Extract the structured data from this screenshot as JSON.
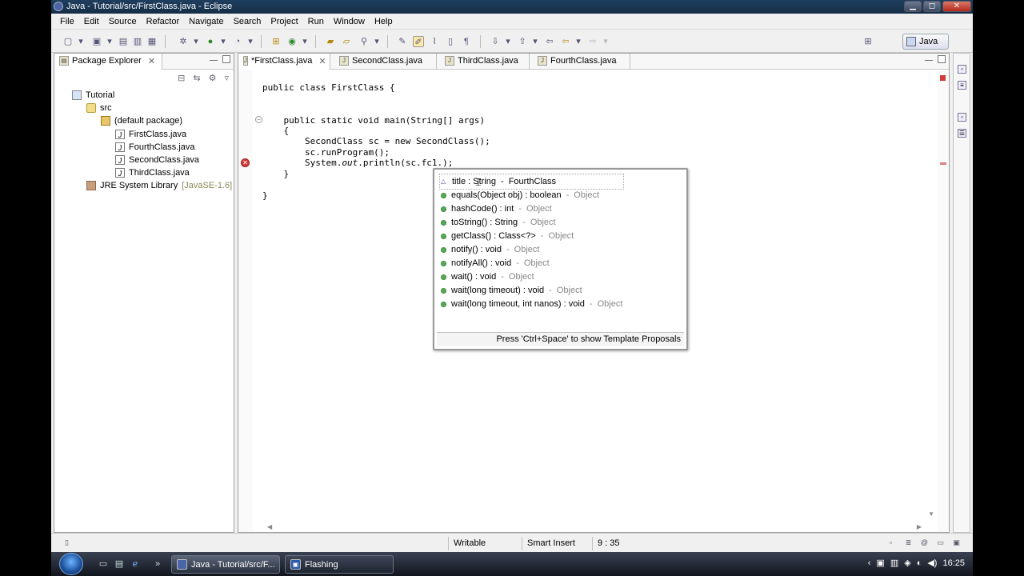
{
  "window": {
    "title": "Java - Tutorial/src/FirstClass.java - Eclipse",
    "min_glyph": "▁",
    "max_glyph": "◻",
    "close_glyph": "✕"
  },
  "menu": [
    "File",
    "Edit",
    "Source",
    "Refactor",
    "Navigate",
    "Search",
    "Project",
    "Run",
    "Window",
    "Help"
  ],
  "toolbar": {
    "perspective_label": "Java"
  },
  "package_explorer": {
    "tab_label": "Package Explorer",
    "close_glyph": "✕",
    "tree": {
      "project": "Tutorial",
      "src": "src",
      "package": "(default package)",
      "files": [
        "FirstClass.java",
        "FourthClass.java",
        "SecondClass.java",
        "ThirdClass.java"
      ],
      "jre_label": "JRE System Library",
      "jre_version": "[JavaSE-1.6]"
    }
  },
  "editor": {
    "tabs": [
      "*FirstClass.java",
      "SecondClass.java",
      "ThirdClass.java",
      "FourthClass.java"
    ],
    "code": {
      "line1": "public class FirstClass {",
      "line2": "    public static void main(String[] args)",
      "line3": "    {",
      "line4": "        SecondClass sc = new SecondClass();",
      "line5": "        sc.runProgram();",
      "line6_pre": "        System.",
      "line6_out": "out",
      "line6_post": ".println(sc.fc1.);",
      "line7": "    }",
      "line8": "}"
    }
  },
  "content_assist": {
    "items": [
      {
        "kind": "field",
        "text": "title : String",
        "decl": "FourthClass"
      },
      {
        "kind": "method",
        "text": "equals(Object obj) : boolean",
        "decl": "Object"
      },
      {
        "kind": "method",
        "text": "hashCode() : int",
        "decl": "Object"
      },
      {
        "kind": "method",
        "text": "toString() : String",
        "decl": "Object"
      },
      {
        "kind": "method",
        "text": "getClass() : Class<?>",
        "decl": "Object"
      },
      {
        "kind": "method",
        "text": "notify() : void",
        "decl": "Object"
      },
      {
        "kind": "method",
        "text": "notifyAll() : void",
        "decl": "Object"
      },
      {
        "kind": "method",
        "text": "wait() : void",
        "decl": "Object"
      },
      {
        "kind": "method",
        "text": "wait(long timeout) : void",
        "decl": "Object"
      },
      {
        "kind": "method",
        "text": "wait(long timeout, int nanos) : void",
        "decl": "Object"
      }
    ],
    "separator": " - ",
    "footer": "Press 'Ctrl+Space' to show Template Proposals"
  },
  "statusbar": {
    "writable": "Writable",
    "insert_mode": "Smart Insert",
    "position": "9 : 35"
  },
  "taskbar": {
    "tasks": [
      "Java - Tutorial/src/F...",
      "Flashing"
    ],
    "clock": "16:25"
  }
}
